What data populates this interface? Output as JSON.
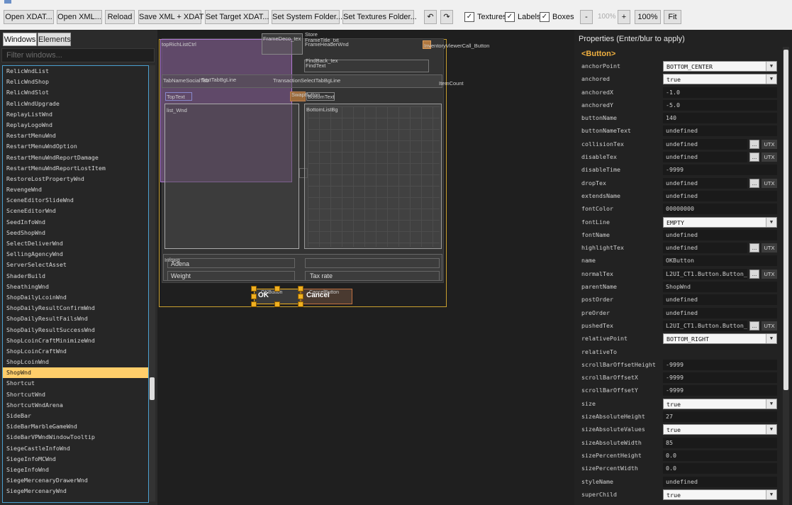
{
  "toolbar": {
    "open_xdat": "Open XDAT...",
    "open_xml": "Open XML...",
    "reload": "Reload",
    "save_xml_xdat": "Save XML + XDAT",
    "set_target_xdat": "Set Target XDAT...",
    "set_system_folder": "Set System Folder...",
    "set_textures_folder": "Set Textures Folder...",
    "undo_icon": "undo-icon",
    "redo_icon": "redo-icon",
    "textures_label": "Textures",
    "textures_checked": true,
    "labels_label": "Labels",
    "labels_checked": true,
    "boxes_label": "Boxes",
    "boxes_checked": true,
    "zoom_out": "-",
    "zoom_value": "100%",
    "zoom_in": "+",
    "zoom_100": "100%",
    "fit": "Fit"
  },
  "left_panel": {
    "tabs": [
      "Windows",
      "Elements"
    ],
    "active_tab": "Windows",
    "filter_placeholder": "Filter windows...",
    "windows": [
      "RelicWndList",
      "RelicWndShop",
      "RelicWndSlot",
      "RelicWndUpgrade",
      "ReplayListWnd",
      "ReplayLogoWnd",
      "RestartMenuWnd",
      "RestartMenuWndOption",
      "RestartMenuWndReportDamage",
      "RestartMenuWndReportLostItem",
      "RestoreLostPropertyWnd",
      "RevengeWnd",
      "SceneEditorSlideWnd",
      "SceneEditorWnd",
      "SeedInfoWnd",
      "SeedShopWnd",
      "SelectDeliverWnd",
      "SellingAgencyWnd",
      "ServerSelectAsset",
      "ShaderBuild",
      "SheathingWnd",
      "ShopDailyLcoinWnd",
      "ShopDailyResultConfirmWnd",
      "ShopDailyResultFailsWnd",
      "ShopDailyResultSuccessWnd",
      "ShopLcoinCraftMinimizeWnd",
      "ShopLcoinCraftWnd",
      "ShopLcoinWnd",
      "ShopWnd",
      "Shortcut",
      "ShortcutWnd",
      "ShortcutWndArena",
      "SideBar",
      "SideBarMarbleGameWnd",
      "SideBarVPWndWindowTooltip",
      "SiegeCastleInfoWnd",
      "SiegeInfoMCWnd",
      "SiegeInfoWnd",
      "SiegeMercenaryDrawerWnd",
      "SiegeMercenaryWnd"
    ],
    "selected": "ShopWnd"
  },
  "canvas": {
    "labels": {
      "topRichListCtrl": "topRichListCtrl",
      "frameDeco": "FrameDeco_tex",
      "store": "Store",
      "frameTitle": "FrameTitle_txt",
      "frameHeader": "FrameHeaderWnd",
      "inventoryViewer": "InventoryViewerCall_Button",
      "findBack": "FindBack_tex",
      "findText": "FindText",
      "tabName": "TabNameSocialTab",
      "tabBgLine": "TabBgLine",
      "tabText": "TextTabBgLine",
      "transactionTab": "TransactionSelectTabBgLine",
      "itemCount": "ItemCount",
      "topText": "TopText",
      "swapButton": "SwapButton",
      "bottomText": "BottomText",
      "listWnd": "list_Wnd",
      "bottomListBg": "BottomListBg",
      "infoBg": "InfoBg",
      "adena": "Adena",
      "weight": "Weight",
      "taxRate": "Tax rate",
      "okButton": "OK",
      "cancelButton": "Cancel",
      "okBtnName": "OKButton",
      "cancelBtnName": "CancelButton"
    }
  },
  "props": {
    "title": "Properties (Enter/blur to apply)",
    "section": "<Button>",
    "items": [
      {
        "name": "anchorPoint",
        "value": "BOTTOM_CENTER",
        "kind": "combo"
      },
      {
        "name": "anchored",
        "value": "true",
        "kind": "combo"
      },
      {
        "name": "anchoredX",
        "value": "-1.0",
        "kind": "text"
      },
      {
        "name": "anchoredY",
        "value": "-5.0",
        "kind": "text"
      },
      {
        "name": "buttonName",
        "value": "140",
        "kind": "text"
      },
      {
        "name": "buttonNameText",
        "value": "undefined",
        "kind": "text"
      },
      {
        "name": "collisionTex",
        "value": "undefined",
        "kind": "tex"
      },
      {
        "name": "disableTex",
        "value": "undefined",
        "kind": "tex"
      },
      {
        "name": "disableTime",
        "value": "-9999",
        "kind": "text"
      },
      {
        "name": "dropTex",
        "value": "undefined",
        "kind": "tex"
      },
      {
        "name": "extendsName",
        "value": "undefined",
        "kind": "text"
      },
      {
        "name": "fontColor",
        "value": "00000000",
        "kind": "text"
      },
      {
        "name": "fontLine",
        "value": "EMPTY",
        "kind": "combo"
      },
      {
        "name": "fontName",
        "value": "undefined",
        "kind": "text"
      },
      {
        "name": "highlightTex",
        "value": "undefined",
        "kind": "tex"
      },
      {
        "name": "name",
        "value": "OKButton",
        "kind": "text"
      },
      {
        "name": "normalTex",
        "value": "L2UI_CT1.Button.Button_",
        "kind": "tex"
      },
      {
        "name": "parentName",
        "value": "ShopWnd",
        "kind": "text"
      },
      {
        "name": "postOrder",
        "value": "undefined",
        "kind": "text"
      },
      {
        "name": "preOrder",
        "value": "undefined",
        "kind": "text"
      },
      {
        "name": "pushedTex",
        "value": "L2UI_CT1.Button.Button_",
        "kind": "tex"
      },
      {
        "name": "relativePoint",
        "value": "BOTTOM_RIGHT",
        "kind": "combo"
      },
      {
        "name": "relativeTo",
        "value": "",
        "kind": "empty"
      },
      {
        "name": "scrollBarOffsetHeight",
        "value": "-9999",
        "kind": "text"
      },
      {
        "name": "scrollBarOffsetX",
        "value": "-9999",
        "kind": "text"
      },
      {
        "name": "scrollBarOffsetY",
        "value": "-9999",
        "kind": "text"
      },
      {
        "name": "size",
        "value": "true",
        "kind": "combo"
      },
      {
        "name": "sizeAbsoluteHeight",
        "value": "27",
        "kind": "text"
      },
      {
        "name": "sizeAbsoluteValues",
        "value": "true",
        "kind": "combo"
      },
      {
        "name": "sizeAbsoluteWidth",
        "value": "85",
        "kind": "text"
      },
      {
        "name": "sizePercentHeight",
        "value": "0.0",
        "kind": "text"
      },
      {
        "name": "sizePercentWidth",
        "value": "0.0",
        "kind": "text"
      },
      {
        "name": "styleName",
        "value": "undefined",
        "kind": "text"
      },
      {
        "name": "superChild",
        "value": "true",
        "kind": "combo"
      }
    ],
    "dots_label": "...",
    "utx_label": "UTX"
  }
}
